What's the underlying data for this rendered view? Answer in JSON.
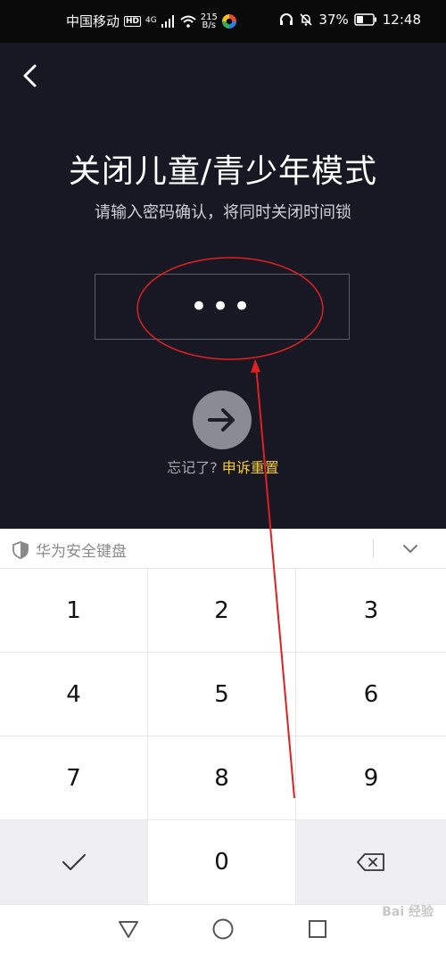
{
  "status_bar": {
    "carrier": "中国移动",
    "hd": "HD",
    "network": "4G",
    "speed_value": "215",
    "speed_unit": "B/s",
    "battery": "37%",
    "time": "12:48"
  },
  "page": {
    "title": "关闭儿童/青少年模式",
    "subtitle": "请输入密码确认，将同时关闭时间锁",
    "password_mask": "•••",
    "forgot_prefix": "忘记了?",
    "forgot_link": "申诉重置"
  },
  "keyboard": {
    "brand": "华为安全键盘",
    "keys": [
      "1",
      "2",
      "3",
      "4",
      "5",
      "6",
      "7",
      "8",
      "9",
      "",
      "0",
      ""
    ]
  },
  "watermark": "Bai 经验",
  "colors": {
    "background": "#171823",
    "link": "#f5c93a",
    "annotation": "#e02020"
  }
}
